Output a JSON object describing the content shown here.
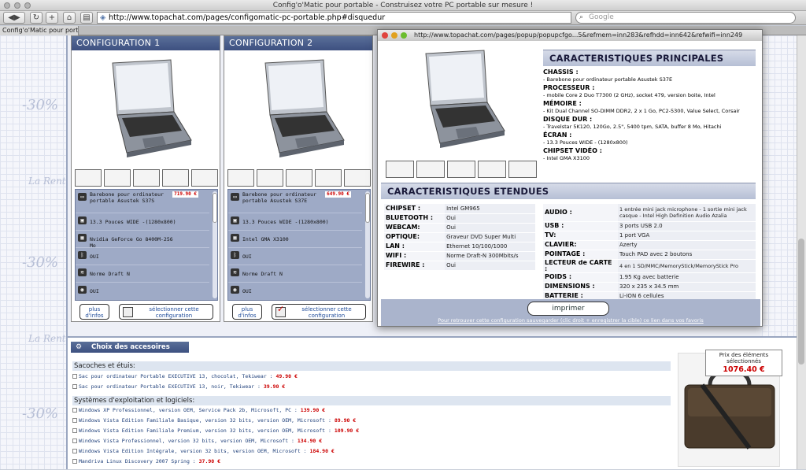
{
  "window": {
    "title": "Config'o'Matic pour portable - Construisez votre PC portable sur mesure !"
  },
  "toolbar": {
    "url": "http://www.topachat.com/pages/configomatic-pc-portable.php#disquedur",
    "search_placeholder": "Google"
  },
  "tabs": [
    {
      "label": "Config'o'Matic pour portable"
    }
  ],
  "configs": [
    {
      "title": "CONFIGURATION 1",
      "items": [
        {
          "icon": "laptop-icon",
          "text": "Barebone pour ordinateur portable Asustek S37S",
          "price": "719.90 €"
        },
        {
          "icon": "monitor-icon",
          "text": "13.3 Pouces WIDE -(1280x800)"
        },
        {
          "icon": "gpu-icon",
          "text": "Nvidia GeForce Go 8400M-256 Mo"
        },
        {
          "icon": "bluetooth-icon",
          "text": "OUI"
        },
        {
          "icon": "wifi-icon",
          "text": "Norme Draft N"
        },
        {
          "icon": "webcam-icon",
          "text": "OUI"
        }
      ],
      "plus_label": "plus d'infos",
      "select_label": "sélectionner cette configuration"
    },
    {
      "title": "CONFIGURATION 2",
      "items": [
        {
          "icon": "laptop-icon",
          "text": "Barebone pour ordinateur portable Asustek S37E",
          "price": "649.90 €"
        },
        {
          "icon": "monitor-icon",
          "text": "13.3 Pouces WIDE -(1280x800)"
        },
        {
          "icon": "gpu-icon",
          "text": "Intel GMA X3100"
        },
        {
          "icon": "bluetooth-icon",
          "text": "OUI"
        },
        {
          "icon": "wifi-icon",
          "text": "Norme Draft N"
        },
        {
          "icon": "webcam-icon",
          "text": "OUI"
        }
      ],
      "plus_label": "plus d'infos",
      "select_label": "sélectionner cette configuration"
    }
  ],
  "popup": {
    "url": "http://www.topachat.com/pages/popup/popupcfgo...5&refmem=inn283&refhdd=inn642&refwifi=inn249",
    "main_title": "CARACTERISTIQUES PRINCIPALES",
    "main_specs": [
      {
        "k": "CHASSIS :",
        "v": "- Barebone pour ordinateur portable Asustek S37E"
      },
      {
        "k": "PROCESSEUR :",
        "v": "- mobile Core 2 Duo T7300 (2 GHz), socket 479, version boite, Intel"
      },
      {
        "k": "MÉMOIRE :",
        "v": "- Kit Dual Channel SO-DIMM DDR2, 2 x 1 Go, PC2-5300, Value Select, Corsair"
      },
      {
        "k": "DISQUE DUR :",
        "v": "- Travelstar 5K120, 120Go, 2.5\", 5400 tpm, SATA, buffer 8 Mo, Hitachi"
      },
      {
        "k": "ÉCRAN :",
        "v": "- 13.3 Pouces WIDE - (1280x800)"
      },
      {
        "k": "CHIPSET VIDÉO :",
        "v": "- Intel GMA X3100"
      }
    ],
    "ext_title": "CARACTERISTIQUES ETENDUES",
    "ext_left": [
      {
        "k": "CHIPSET :",
        "v": "Intel GM965"
      },
      {
        "k": "BLUETOOTH :",
        "v": "Oui"
      },
      {
        "k": "WEBCAM:",
        "v": "Oui"
      },
      {
        "k": "OPTIQUE:",
        "v": "Graveur DVD Super Multi"
      },
      {
        "k": "LAN :",
        "v": "Ethernet 10/100/1000"
      },
      {
        "k": "WIFI :",
        "v": "Norme Draft-N 300Mbits/s"
      },
      {
        "k": "FIREWIRE :",
        "v": "Oui"
      }
    ],
    "ext_right": [
      {
        "k": "AUDIO :",
        "v": "1 entrée mini jack microphone - 1 sortie mini jack casque - Intel High Definition Audio Azalia"
      },
      {
        "k": "USB :",
        "v": "3 ports USB 2.0"
      },
      {
        "k": "TV:",
        "v": "1 port VGA"
      },
      {
        "k": "CLAVIER:",
        "v": "Azerty"
      },
      {
        "k": "POINTAGE :",
        "v": "Touch PAD avec 2 boutons"
      },
      {
        "k": "LECTEUR de CARTE :",
        "v": "4 en 1 SD/MMC/MemoryStick/MemoryStick Pro"
      },
      {
        "k": "POIDS :",
        "v": "1.95 Kg avec batterie"
      },
      {
        "k": "DIMENSIONS :",
        "v": "320 x 235 x 34.5 mm"
      },
      {
        "k": "BATTERIE :",
        "v": "Li-ION 6 cellules"
      }
    ],
    "print_label": "imprimer",
    "save_link": "Pour retrouver cette configuration sauvegarder (clic droit + enregistrer la cible) ce lien dans vos favoris"
  },
  "accessories": {
    "title": "Choix des accesoires",
    "categories": [
      {
        "title": "Sacoches et étuis:",
        "items": [
          {
            "text": "Sac pour ordinateur Portable EXECUTIVE 13, chocolat, Tekiwear :",
            "price": "49.90 €"
          },
          {
            "text": "Sac pour ordinateur Portable EXECUTIVE 13, noir, Tekiwear :",
            "price": "39.90 €"
          }
        ]
      },
      {
        "title": "Systèmes d'exploitation et logiciels:",
        "items": [
          {
            "text": "Windows XP Professionnel, version OEM, Service Pack 2b, Microsoft, PC :",
            "price": "139.90 €"
          },
          {
            "text": "Windows Vista Edition Familiale Basique, version 32 bits, version OEM, Microsoft :",
            "price": "89.90 €"
          },
          {
            "text": "Windows Vista Edition Familiale Premium, version 32 bits, version OEM, Microsoft :",
            "price": "109.90 €"
          },
          {
            "text": "Windows Vista Professionnel, version 32 bits, version OEM, Microsoft :",
            "price": "134.90 €"
          },
          {
            "text": "Windows Vista Edition Intégrale, version 32 bits, version OEM, Microsoft :",
            "price": "184.90 €"
          },
          {
            "text": "Mandriva Linux Discovery 2007 Spring :",
            "price": "37.90 €"
          }
        ]
      }
    ],
    "price_box": {
      "label": "Prix des éléments sélectionnés",
      "total": "1076.40 €"
    }
  },
  "decor": {
    "marks": [
      "-30%",
      "-30%",
      "-30%",
      "-30%"
    ],
    "brand": "La Rent"
  }
}
